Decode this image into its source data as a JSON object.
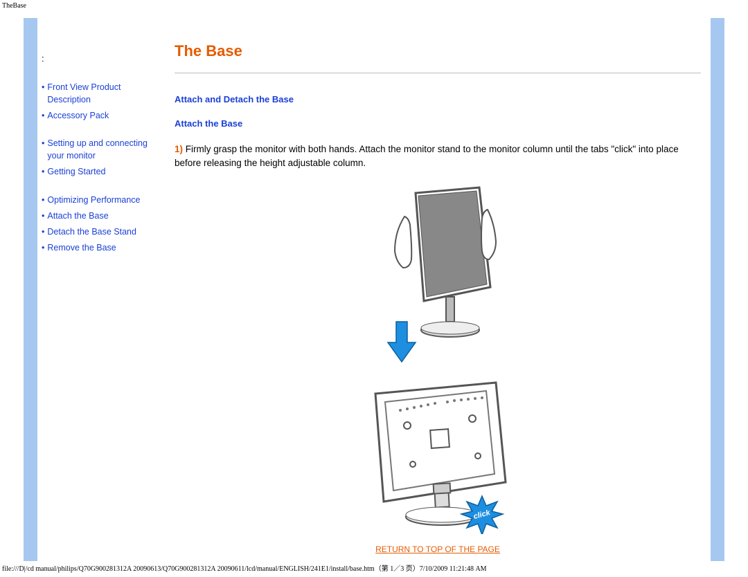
{
  "header": {
    "breadcrumb": "TheBase"
  },
  "sidebar": {
    "prefix": ":",
    "items": [
      {
        "label": "Front View Product Description",
        "link": true
      },
      {
        "label": "Accessory Pack",
        "link": true
      },
      {
        "label": "Setting up and connecting your monitor",
        "link": true,
        "break_before": true
      },
      {
        "label": "Getting Started",
        "link": true
      },
      {
        "label": "Optimizing Performance",
        "link": true,
        "break_before": true
      },
      {
        "label": "Attach the Base",
        "link": false
      },
      {
        "label": "Detach the Base Stand",
        "link": false
      },
      {
        "label": "Remove the Base",
        "link": false
      }
    ]
  },
  "main": {
    "title": "The Base",
    "section_heading": "Attach and Detach the Base",
    "subsection_heading": "Attach the Base",
    "step_number": "1)",
    "step_text": "Firmly grasp the monitor with both hands. Attach the monitor stand to the monitor column until the tabs \"click\" into place before releasing the height adjustable column.",
    "badge_text": "click",
    "return_link": "RETURN TO TOP OF THE PAGE"
  },
  "footer": {
    "text": "file:///D|/cd manual/philips/Q70G900281312A 20090613/Q70G900281312A 20090611/lcd/manual/ENGLISH/241E1/install/base.htm（第 1／3 页）7/10/2009 11:21:48 AM"
  },
  "icons": {
    "arrow": "arrow-down-icon",
    "click_badge": "click-badge-icon"
  }
}
